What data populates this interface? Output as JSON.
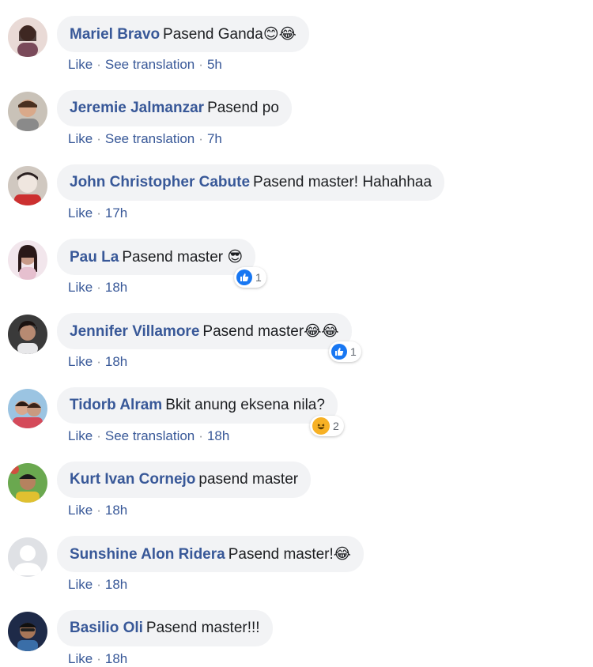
{
  "comments": [
    {
      "name": "Mariel Bravo",
      "text": "Pasend Ganda",
      "emoji": "😊😂",
      "actions": [
        "Like",
        "See translation",
        "5h"
      ]
    },
    {
      "name": "Jeremie Jalmanzar",
      "text": "Pasend po",
      "emoji": "",
      "actions": [
        "Like",
        "See translation",
        "7h"
      ]
    },
    {
      "name": "John Christopher Cabute",
      "text": "Pasend master! Hahahhaa",
      "emoji": "",
      "actions": [
        "Like",
        "17h"
      ]
    },
    {
      "name": "Pau La",
      "text": "Pasend master",
      "emoji": "😎",
      "actions": [
        "Like",
        "18h"
      ],
      "reaction": {
        "type": "like",
        "count": "1"
      }
    },
    {
      "name": "Jennifer Villamore",
      "text": "Pasend master",
      "emoji": "😂😂",
      "actions": [
        "Like",
        "18h"
      ],
      "reaction": {
        "type": "like",
        "count": "1"
      }
    },
    {
      "name": "Tidorb Alram",
      "text": "Bkit anung eksena nila?",
      "emoji": "",
      "actions": [
        "Like",
        "See translation",
        "18h"
      ],
      "reaction": {
        "type": "haha",
        "count": "2"
      }
    },
    {
      "name": "Kurt Ivan Cornejo",
      "text": "pasend master",
      "emoji": "",
      "actions": [
        "Like",
        "18h"
      ]
    },
    {
      "name": "Sunshine Alon Ridera",
      "text": "Pasend master!",
      "emoji": "😂",
      "actions": [
        "Like",
        "18h"
      ]
    },
    {
      "name": "Basilio Oli",
      "text": "Pasend master!!!",
      "emoji": "",
      "actions": [
        "Like",
        "18h"
      ]
    }
  ],
  "colors": {
    "name": "#385898",
    "bubble": "#f2f3f5",
    "like": "#1877f2",
    "haha": "#f7b125"
  }
}
